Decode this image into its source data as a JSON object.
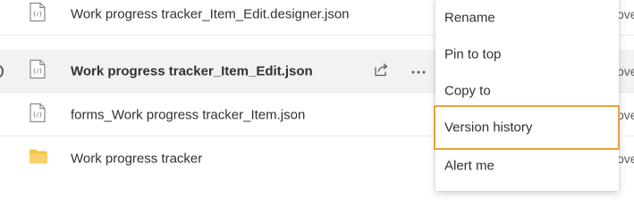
{
  "files": [
    {
      "name": "Work progress tracker_Item_Edit.designer.json",
      "icon": "json-file-icon",
      "selected": false,
      "modified_stub": "ove"
    },
    {
      "name": "Work progress tracker_Item_Edit.json",
      "icon": "json-file-icon",
      "selected": true,
      "modified_stub": "ove"
    },
    {
      "name": "forms_Work progress tracker_Item.json",
      "icon": "json-file-icon",
      "selected": false,
      "modified_stub": "ove"
    },
    {
      "name": "Work progress tracker",
      "icon": "folder-icon",
      "selected": false,
      "modified_stub": "ove"
    }
  ],
  "context_menu": {
    "items": [
      "Rename",
      "Pin to top",
      "Copy to",
      "Version history",
      "Alert me"
    ],
    "highlighted": "Version history"
  },
  "colors": {
    "selected_row": "#f3f2f1",
    "highlight_border": "#e8a33b",
    "folder": "#f4c342",
    "text": "#323130"
  }
}
